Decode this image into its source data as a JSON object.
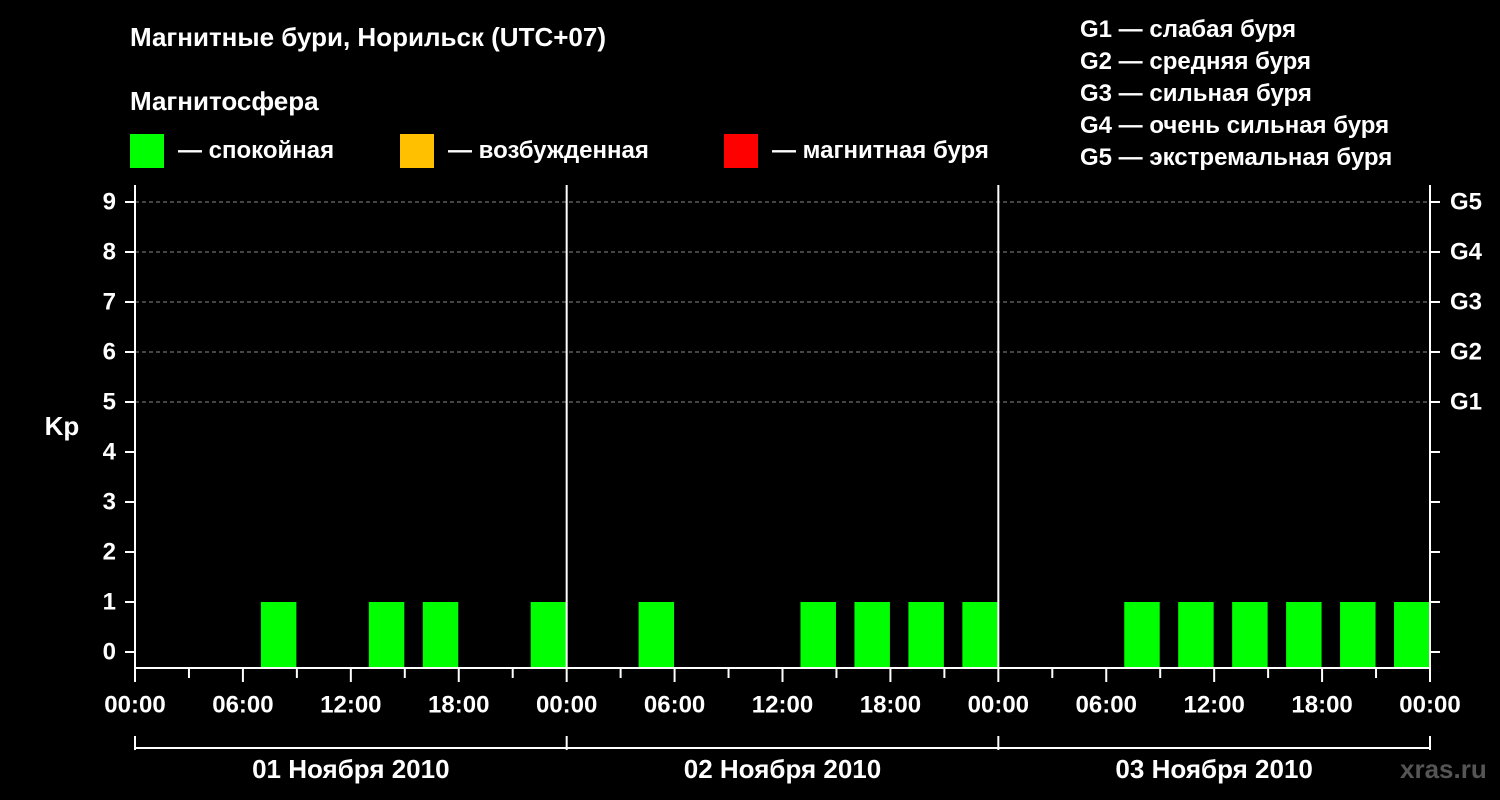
{
  "title": "Магнитные бури, Норильск (UTC+07)",
  "magnetosphere": {
    "heading": "Магнитосфера",
    "legend": [
      {
        "label": "— спокойная",
        "color": "#00ff00"
      },
      {
        "label": "— возбужденная",
        "color": "#ffc000"
      },
      {
        "label": "— магнитная буря",
        "color": "#ff0000"
      }
    ]
  },
  "storm_scale": [
    "G1 — слабая буря",
    "G2 — средняя буря",
    "G3 — сильная буря",
    "G4 — очень сильная буря",
    "G5 — экстремальная буря"
  ],
  "watermark": "xras.ru",
  "chart_data": {
    "type": "bar",
    "ylabel": "Kp",
    "ylim": [
      0,
      9
    ],
    "y_ticks": [
      "0",
      "1",
      "2",
      "3",
      "4",
      "5",
      "6",
      "7",
      "8",
      "9"
    ],
    "right_ticks": [
      {
        "kp": 5,
        "label": "G1"
      },
      {
        "kp": 6,
        "label": "G2"
      },
      {
        "kp": 7,
        "label": "G3"
      },
      {
        "kp": 8,
        "label": "G4"
      },
      {
        "kp": 9,
        "label": "G5"
      }
    ],
    "grid": "dashed horizontal at Kp 5-9",
    "x_ticks": [
      "00:00",
      "06:00",
      "12:00",
      "18:00",
      "00:00",
      "06:00",
      "12:00",
      "18:00",
      "00:00",
      "06:00",
      "12:00",
      "18:00",
      "00:00"
    ],
    "days": [
      "01 Ноября 2010",
      "02 Ноября 2010",
      "03 Ноября 2010"
    ],
    "interval_hours": 3,
    "kp": [
      [
        0,
        0,
        1,
        0,
        1,
        1,
        0,
        1
      ],
      [
        0,
        1,
        0,
        0,
        1,
        1,
        1,
        1
      ],
      [
        0,
        0,
        1,
        1,
        1,
        1,
        1,
        1
      ]
    ],
    "bar_color": "#00ff00"
  }
}
